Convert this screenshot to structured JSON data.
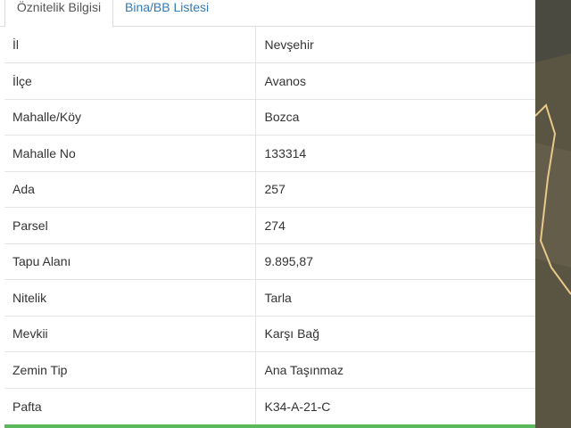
{
  "tabs": [
    {
      "label": "Öznitelik Bilgisi",
      "active": true
    },
    {
      "label": "Bina/BB Listesi",
      "active": false
    }
  ],
  "attributes": [
    {
      "key": "İl",
      "value": "Nevşehir"
    },
    {
      "key": "İlçe",
      "value": "Avanos"
    },
    {
      "key": "Mahalle/Köy",
      "value": "Bozca"
    },
    {
      "key": "Mahalle No",
      "value": "133314"
    },
    {
      "key": "Ada",
      "value": "257"
    },
    {
      "key": "Parsel",
      "value": "274"
    },
    {
      "key": "Tapu Alanı",
      "value": "9.895,87"
    },
    {
      "key": "Nitelik",
      "value": "Tarla"
    },
    {
      "key": "Mevkii",
      "value": "Karşı Bağ"
    },
    {
      "key": "Zemin Tip",
      "value": "Ana Taşınmaz"
    },
    {
      "key": "Pafta",
      "value": "K34-A-21-C"
    }
  ],
  "colors": {
    "tab_link": "#337ab7",
    "accent_bar": "#5cb85c",
    "parcel_outline": "#e8c98a"
  }
}
